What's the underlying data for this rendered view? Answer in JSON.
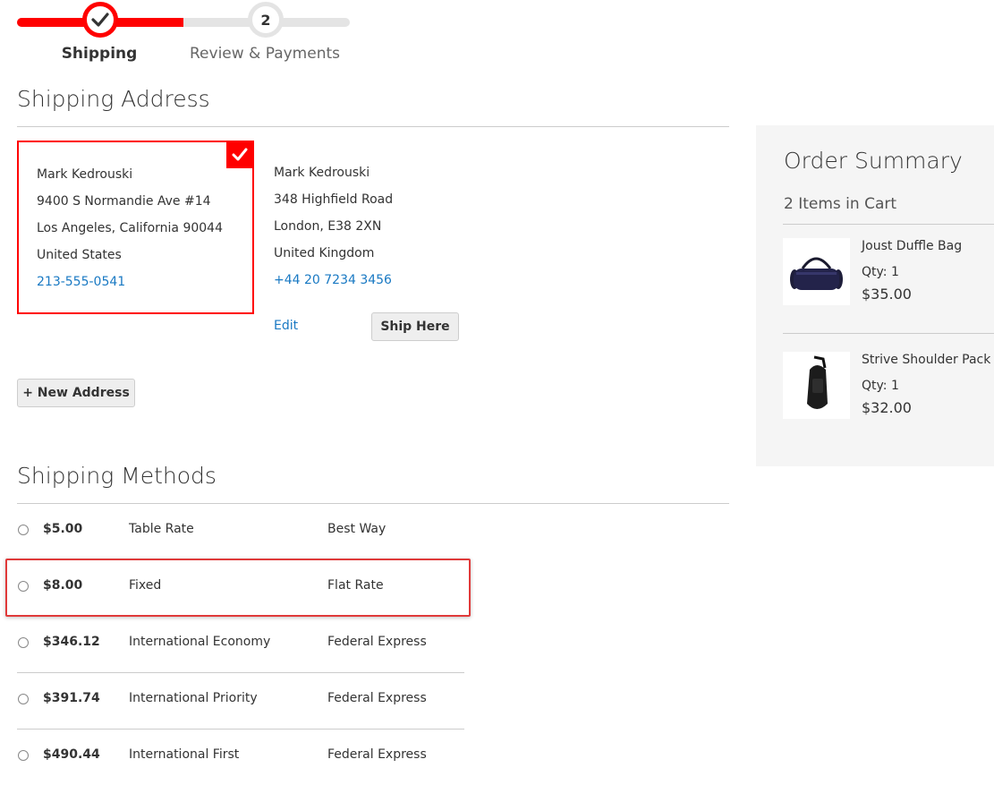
{
  "progress": {
    "steps": [
      {
        "number": "",
        "label": "Shipping",
        "status": "complete"
      },
      {
        "number": "2",
        "label": "Review & Payments",
        "status": "upcoming"
      }
    ],
    "completed_fraction": 0.5,
    "accent_color": "#ff0000"
  },
  "shipping_address": {
    "title": "Shipping Address",
    "selected": {
      "name": "Mark Kedrouski",
      "street": "9400 S Normandie Ave #14",
      "city_line": "Los Angeles, California 90044",
      "country": "United States",
      "phone": "213-555-0541"
    },
    "other": {
      "name": "Mark Kedrouski",
      "street": "348 Highfield Road",
      "city_line": "London, E38 2XN",
      "country": "United Kingdom",
      "phone": "+44 20 7234 3456",
      "edit_label": "Edit",
      "ship_here_label": "Ship Here"
    },
    "new_address_label": "+ New Address"
  },
  "shipping_methods": {
    "title": "Shipping Methods",
    "rows": [
      {
        "price": "$5.00",
        "method": "Table Rate",
        "carrier": "Best Way"
      },
      {
        "price": "$8.00",
        "method": "Fixed",
        "carrier": "Flat Rate"
      },
      {
        "price": "$346.12",
        "method": "International Economy",
        "carrier": "Federal Express"
      },
      {
        "price": "$391.74",
        "method": "International Priority",
        "carrier": "Federal Express"
      },
      {
        "price": "$490.44",
        "method": "International First",
        "carrier": "Federal Express"
      }
    ]
  },
  "order_summary": {
    "title": "Order Summary",
    "items_count": "2 Items in Cart",
    "items": [
      {
        "name": "Joust Duffle Bag",
        "qty": "Qty: 1",
        "price": "$35.00",
        "icon": "duffle-bag-image"
      },
      {
        "name": "Strive Shoulder Pack",
        "qty": "Qty: 1",
        "price": "$32.00",
        "icon": "shoulder-pack-image"
      }
    ]
  }
}
